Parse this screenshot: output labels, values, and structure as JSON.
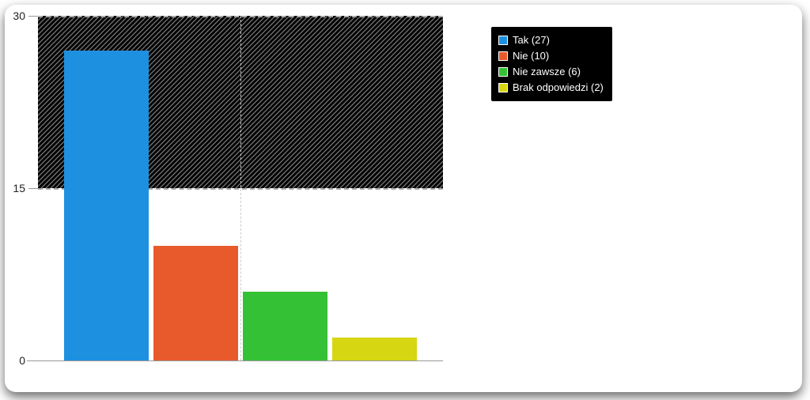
{
  "chart_data": {
    "type": "bar",
    "categories": [
      "Tak",
      "Nie",
      "Nie zawsze",
      "Brak odpowiedzi"
    ],
    "values": [
      27,
      10,
      6,
      2
    ],
    "colors": [
      "#1e90e0",
      "#e85a2c",
      "#35c135",
      "#d6d612"
    ],
    "ylim": [
      0,
      30
    ],
    "yticks": [
      0,
      15,
      30
    ],
    "legend_labels": [
      "Tak (27)",
      "Nie (10)",
      "Nie zawsze (6)",
      "Brak odpowiedzi (2)"
    ]
  }
}
